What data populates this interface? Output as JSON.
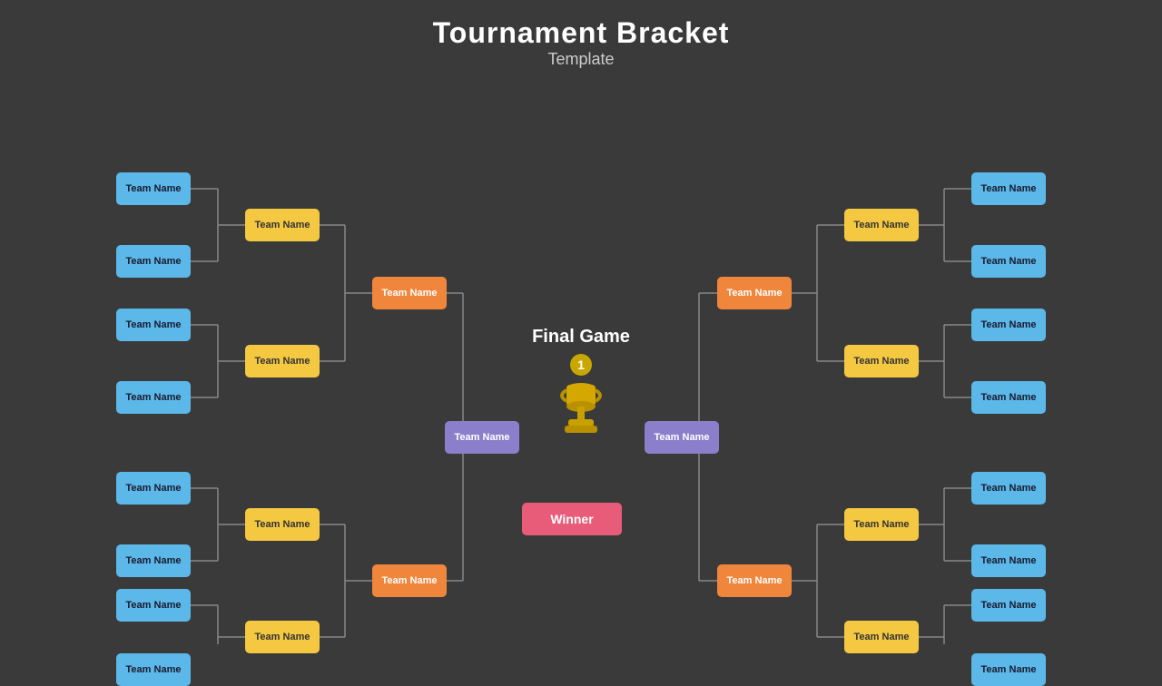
{
  "title": "Tournament Bracket",
  "subtitle": "Template",
  "finalGame": "Final Game",
  "winner": "Winner",
  "teams": {
    "label": "Team Name"
  },
  "colors": {
    "blue": "#5bb8e8",
    "yellow": "#f5c842",
    "orange": "#f0863c",
    "pink": "#e85c7a",
    "purple": "#8b7fcb",
    "bg": "#3a3a3a"
  }
}
